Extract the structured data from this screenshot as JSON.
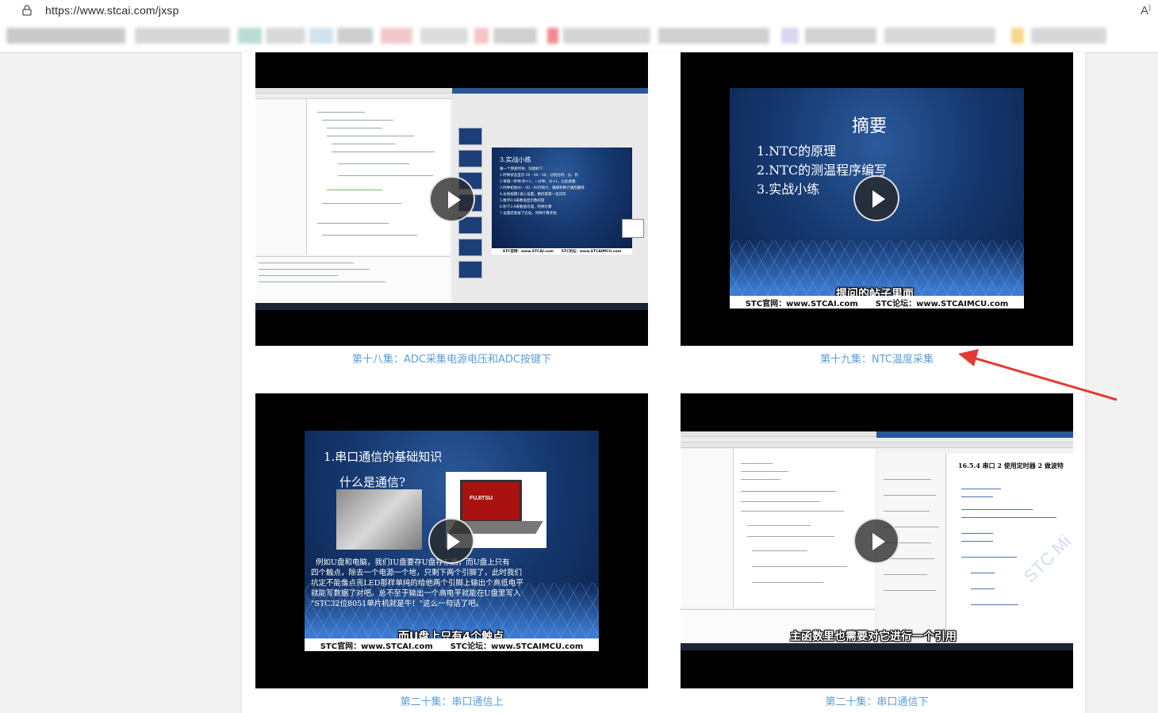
{
  "browser": {
    "url": "https://www.stcai.com/jxsp",
    "reader_label": "A҆"
  },
  "colors": {
    "caption": "#5aa0d8",
    "arrow": "#e53935",
    "slide_bg": "#173a72"
  },
  "videos": [
    {
      "caption": "第十八集：ADC采集电源电压和ADC按键下",
      "slide_title": "3.实战小练",
      "slide_lines": [
        "做一个简易时钟，功能如下：",
        "1.时钟状态显示 00 - 00 - 00，分别为时、分、秒",
        "2.每隔一秒钟,秒+1，一分钟，分+1，以此类推",
        "3.时钟初始00 - 00 - 00开始计，确保秒钟计满后翻转",
        "4.长按按键1进入设置，数码管第一位闪烁",
        "5.数字0-9来数值显示数码管",
        "6.秒下3-9来数值可调，时钟计算",
        "7.设置结束按下启动，时钟计算开始"
      ],
      "footer_left": "STC官网：www.STCAI.com",
      "footer_right": "STC论坛：www.STCAIMCU.com"
    },
    {
      "caption": "第十九集：NTC温度采集",
      "slide_title": "摘要",
      "slide_lines": [
        "1.NTC的原理",
        "2.NTC的测温程序编写",
        "3.实战小练"
      ],
      "subtitle": "提问的帖子里面",
      "footer_left": "STC官网：www.STCAI.com",
      "footer_right": "STC论坛：www.STCAIMCU.com"
    },
    {
      "caption": "第二十集：串口通信上",
      "slide_title": "1.串口通信的基础知识",
      "slide_question": "什么是通信?",
      "laptop_brand": "FUJITSU",
      "slide_paragraph_1": "例如U盘和电脑，我们IU盘要存U盘存东西，而U盘上只有",
      "slide_paragraph_2": "四个触点，除去一个电源一个地，只剩下两个引脚了，此时我们",
      "slide_paragraph_3": "坑定不能像点亮LED那样单纯的给他两个引脚上输出个高低电平",
      "slide_paragraph_4": "就能写数据了对吧。总不至于输出一个高电平就能在U盘里写入",
      "slide_paragraph_5": "\"STC32位8051单片机就是牛！\"这么一句话了吧。",
      "subtitle": "而U盘上只有4个触点",
      "footer_left": "STC官网：www.STCAI.com",
      "footer_right": "STC论坛：www.STCAIMCU.com"
    },
    {
      "caption": "第二十集：串口通信下",
      "doc_heading": "16.5.4 串口 2 使用定时器 2 做波特",
      "watermark": "STC Mi",
      "subtitle": "主函数里也需要对它进行一个引用"
    }
  ]
}
